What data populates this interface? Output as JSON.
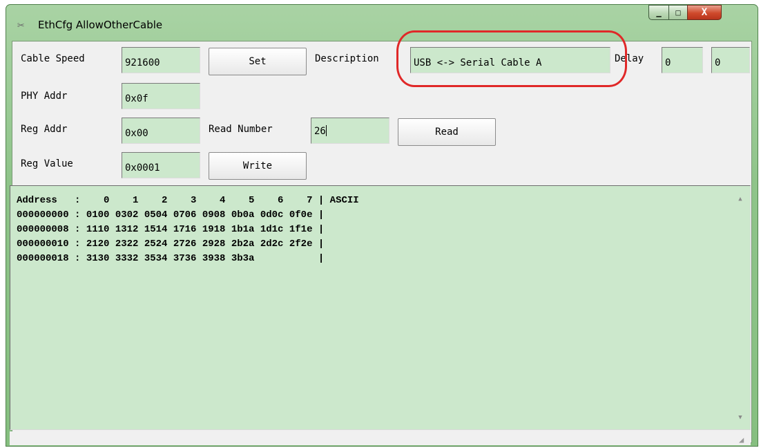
{
  "window": {
    "title": "EthCfg AllowOtherCable",
    "icon": "tools-icon"
  },
  "controls": {
    "minimize": "—",
    "maximize": "□",
    "close": "X"
  },
  "form": {
    "cable_speed_label": "Cable Speed",
    "cable_speed_value": "921600",
    "set_label": "Set",
    "description_label": "Description",
    "description_value": "USB <-> Serial Cable A",
    "delay_label": "Delay",
    "delay_value1": "0",
    "delay_value2": "0",
    "phy_addr_label": "PHY Addr",
    "phy_addr_value": "0x0f",
    "reg_addr_label": "Reg Addr",
    "reg_addr_value": "0x00",
    "read_number_label": "Read Number",
    "read_number_value": "26",
    "read_label": "Read",
    "reg_value_label": "Reg Value",
    "reg_value_value": "0x0001",
    "write_label": "Write"
  },
  "memo": {
    "lines": [
      "Address   :    0    1    2    3    4    5    6    7 | ASCII",
      "000000000 : 0100 0302 0504 0706 0908 0b0a 0d0c 0f0e |",
      "000000008 : 1110 1312 1514 1716 1918 1b1a 1d1c 1f1e |",
      "000000010 : 2120 2322 2524 2726 2928 2b2a 2d2c 2f2e |",
      "000000018 : 3130 3332 3534 3736 3938 3b3a           |"
    ]
  },
  "colors": {
    "field_bg": "#cce8cc",
    "frame": "#8fc48a",
    "annotation": "#e02828"
  }
}
